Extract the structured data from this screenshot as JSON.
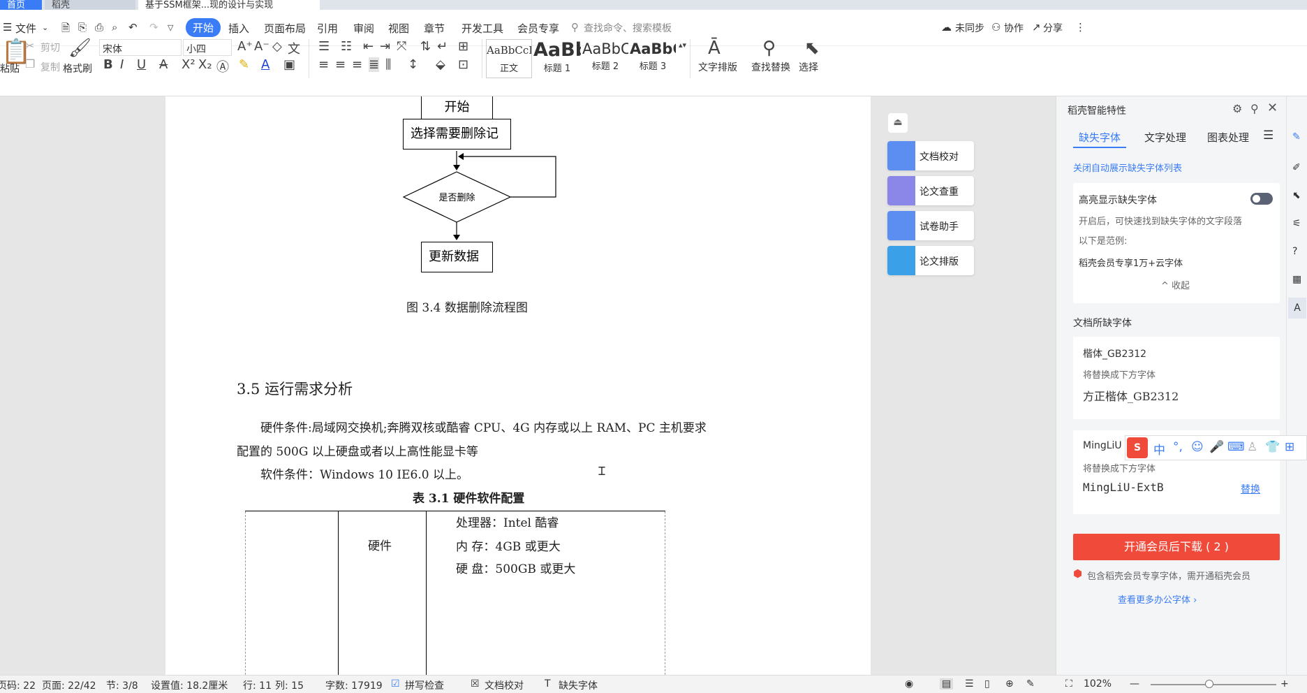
{
  "tabs": [
    {
      "label": "首页"
    },
    {
      "label": "稻壳"
    },
    {
      "label": "基于SSM框架...现的设计与实现"
    }
  ],
  "menu": {
    "file": "文件",
    "items": [
      "开始",
      "插入",
      "页面布局",
      "引用",
      "审阅",
      "视图",
      "章节",
      "开发工具",
      "会员专享"
    ],
    "search_placeholder": "查找命令、搜索模板",
    "right": [
      "未同步",
      "协作",
      "分享"
    ]
  },
  "ribbon": {
    "paste": "粘贴",
    "cut": "剪切",
    "copy": "复制",
    "format_painter": "格式刷",
    "font_name": "宋体",
    "font_size": "小四",
    "styles": [
      {
        "preview": "AaBbCcDd",
        "label": "正文"
      },
      {
        "preview": "AaBb",
        "label": "标题 1"
      },
      {
        "preview": "AaBbC",
        "label": "标题 2"
      },
      {
        "preview": "AaBbC",
        "label": "标题 3"
      }
    ],
    "text_layout": "文字排版",
    "find_replace": "查找替换",
    "select": "选择"
  },
  "document": {
    "flow_start": "开始",
    "flow_select": "选择需要删除记",
    "flow_decision": "是否删除",
    "flow_update": "更新数据",
    "figure_caption": "图 3.4  数据删除流程图",
    "section_heading": "3.5 运行需求分析",
    "para1_line1": "硬件条件:局域网交换机;奔腾双核或酷睿 CPU、4G 内存或以上 RAM、PC 主机要求",
    "para1_line2": "配置的 500G 以上硬盘或者以上高性能显卡等",
    "para2": "软件条件：Windows 10   IE6.0 以上。",
    "table_caption": "表 3.1  硬件软件配置",
    "table_cell_hw": "硬件",
    "table_row1": "处理器：Intel  酷睿",
    "table_row2": "内  存：4GB  或更大",
    "table_row3": "硬  盘：500GB  或更大"
  },
  "float_tools": [
    "文档校对",
    "论文查重",
    "试卷助手",
    "论文排版"
  ],
  "panel": {
    "title": "稻壳智能特性",
    "tabs": [
      "缺失字体",
      "文字处理",
      "图表处理"
    ],
    "close_auto": "关闭自动展示缺失字体列表",
    "highlight_title": "高亮显示缺失字体",
    "highlight_desc": "开启后，可快速找到缺失字体的文字段落",
    "example_label": "以下是范例:",
    "example_text": "稻壳会员专享1万+云字体",
    "collapse": "收起",
    "missing_fonts_heading": "文档所缺字体",
    "fonts": [
      {
        "name": "楷体_GB2312",
        "replace_hint": "将替换成下方字体",
        "replacement": "方正楷体_GB2312"
      },
      {
        "name": "MingLiU",
        "replace_hint": "将替换成下方字体",
        "replacement": "MingLiU-ExtB",
        "action": "替换"
      }
    ],
    "download_button": "开通会员后下载 ( 2 )",
    "member_note": "包含稻壳会员专享字体，需开通稻壳会员",
    "more_fonts": "查看更多办公字体"
  },
  "status": {
    "page_code": "页码: 22",
    "pages": "页面: 22/42",
    "section": "节: 3/8",
    "setting": "设置值: 18.2厘米",
    "row": "行: 11",
    "col": "列: 15",
    "words": "字数: 17919",
    "spell": "拼写检查",
    "proof": "文档校对",
    "missing_font": "缺失字体",
    "zoom": "102%"
  },
  "ime": {
    "label": "中"
  },
  "colors": {
    "accent": "#3a7cf5",
    "download": "#f04a3a",
    "link": "#3a7cf5"
  }
}
